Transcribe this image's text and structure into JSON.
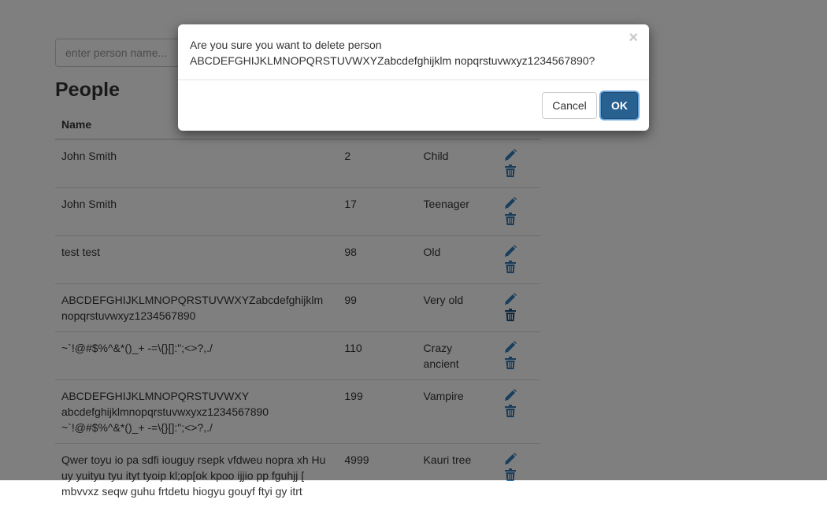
{
  "search": {
    "placeholder": "enter person name..."
  },
  "people": {
    "title": "People",
    "columns": {
      "name": "Name"
    },
    "rows": [
      {
        "name": "John Smith",
        "age": "2",
        "category": "Child"
      },
      {
        "name": "John Smith",
        "age": "17",
        "category": "Teenager"
      },
      {
        "name": "test test",
        "age": "98",
        "category": "Old"
      },
      {
        "name": "ABCDEFGHIJKLMNOPQRSTUVWXYZabcdefghijklm nopqrstuvwxyz1234567890",
        "age": "99",
        "category": "Very old"
      },
      {
        "name": "~`!@#$%^&*()_+ -=\\{}[]:\";<>?,./",
        "age": "110",
        "category": "Crazy ancient"
      },
      {
        "name": "ABCDEFGHIJKLMNOPQRSTUVWXY abcdefghijklmnopqrstuvwxyxz1234567890 ~`!@#$%^&*()_+ -=\\{}[]:\";<>?,./",
        "age": "199",
        "category": "Vampire"
      },
      {
        "name": "Qwer toyu io pa sdfi iouguy rsepk vfdweu nopra xh Hu uy yuityu tyu ityt tyoip kl;op[ok kpoo ijjio pp fguhjj [ mbvvxz seqw guhu frtdetu hiogyu gouyf ftyi gy itrt",
        "age": "4999",
        "category": "Kauri tree"
      }
    ],
    "icons": {
      "edit": "pencil-icon",
      "delete": "trash-icon"
    }
  },
  "modal": {
    "message": "Are you sure you want to delete person ABCDEFGHIJKLMNOPQRSTUVWXYZabcdefghijklm nopqrstuvwxyz1234567890?",
    "close_label": "×",
    "cancel_label": "Cancel",
    "ok_label": "OK"
  },
  "colors": {
    "accent": "#286090",
    "icon": "#337ab7",
    "overlay": "rgba(0,0,0,0.5)"
  }
}
